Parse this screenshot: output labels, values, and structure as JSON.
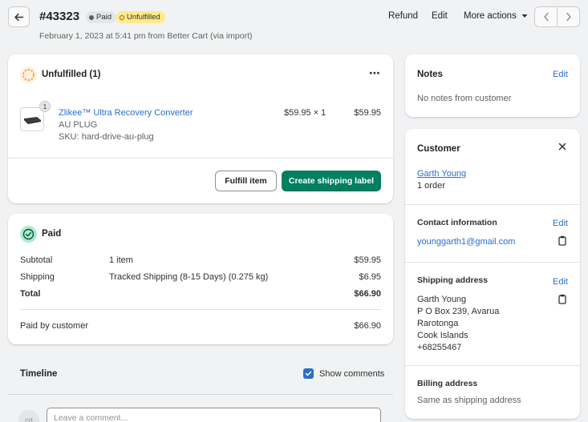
{
  "header": {
    "order_number": "#43323",
    "badge_paid": "Paid",
    "badge_unfulfilled": "Unfulfilled",
    "subline": "February 1, 2023 at 5:41 pm from Better Cart (via import)",
    "refund": "Refund",
    "edit": "Edit",
    "more_actions": "More actions"
  },
  "fulfillment": {
    "title": "Unfulfilled (1)",
    "item": {
      "quantity": "1",
      "name": "Zlikee™ Ultra Recovery Converter",
      "variant": "AU PLUG",
      "sku": "SKU: hard-drive-au-plug",
      "unit_price": "$59.95 × 1",
      "total": "$59.95"
    },
    "fulfill_button": "Fulfill item",
    "shipping_label_button": "Create shipping label"
  },
  "payment": {
    "title": "Paid",
    "rows": [
      {
        "label": "Subtotal",
        "detail": "1 item",
        "amount": "$59.95"
      },
      {
        "label": "Shipping",
        "detail": "Tracked Shipping (8-15 Days) (0.275 kg)",
        "amount": "$6.95"
      },
      {
        "label": "Total",
        "detail": "",
        "amount": "$66.90"
      }
    ],
    "paid_by_label": "Paid by customer",
    "paid_by_amount": "$66.90"
  },
  "timeline": {
    "title": "Timeline",
    "show_comments": "Show comments",
    "avatar_initials": "cd",
    "comment_placeholder": "Leave a comment..."
  },
  "notes": {
    "title": "Notes",
    "edit": "Edit",
    "text": "No notes from customer"
  },
  "customer": {
    "title": "Customer",
    "name": "Garth Young",
    "orders": "1 order",
    "contact_title": "Contact information",
    "contact_edit": "Edit",
    "email": "younggarth1@gmail.com",
    "shipping_title": "Shipping address",
    "shipping_edit": "Edit",
    "address_lines": [
      "Garth Young",
      "P O Box 239, Avarua",
      "Rarotonga",
      "Cook Islands",
      "+68255467"
    ],
    "billing_title": "Billing address",
    "billing_text": "Same as shipping address"
  },
  "colors": {
    "primary": "#008060",
    "link": "#2c6ecb",
    "unfulfilled_badge": "#ffea8a",
    "paid_icon": "#00a47c",
    "unfulfilled_icon": "#f0a735"
  }
}
